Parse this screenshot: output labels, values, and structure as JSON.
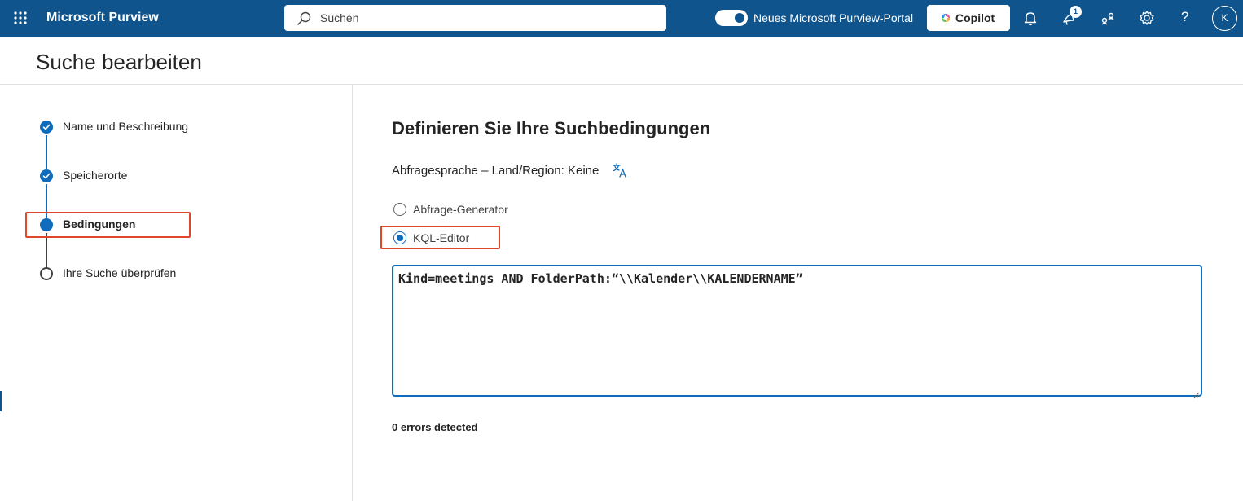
{
  "header": {
    "app_title": "Microsoft Purview",
    "search_placeholder": "Suchen",
    "toggle_label": "Neues Microsoft Purview-Portal",
    "copilot_label": "Copilot",
    "notification_badge": "1",
    "help_label": "?",
    "avatar_initial": "K"
  },
  "page": {
    "title": "Suche bearbeiten"
  },
  "stepper": {
    "steps": [
      {
        "label": "Name und Beschreibung",
        "state": "done"
      },
      {
        "label": "Speicherorte",
        "state": "done"
      },
      {
        "label": "Bedingungen",
        "state": "current"
      },
      {
        "label": "Ihre Suche überprüfen",
        "state": "todo"
      }
    ]
  },
  "main": {
    "heading": "Definieren Sie Ihre Suchbedingungen",
    "query_language": "Abfragesprache – Land/Region: Keine",
    "options": [
      {
        "label": "Abfrage-Generator",
        "selected": false
      },
      {
        "label": "KQL-Editor",
        "selected": true
      }
    ],
    "kql_query": "Kind=meetings AND FolderPath:“\\\\Kalender\\\\KALENDERNAME”",
    "errors_text": "0 errors detected"
  },
  "colors": {
    "header_bg": "#0f548c",
    "accent": "#0f6cbd",
    "highlight": "#e0462a"
  }
}
